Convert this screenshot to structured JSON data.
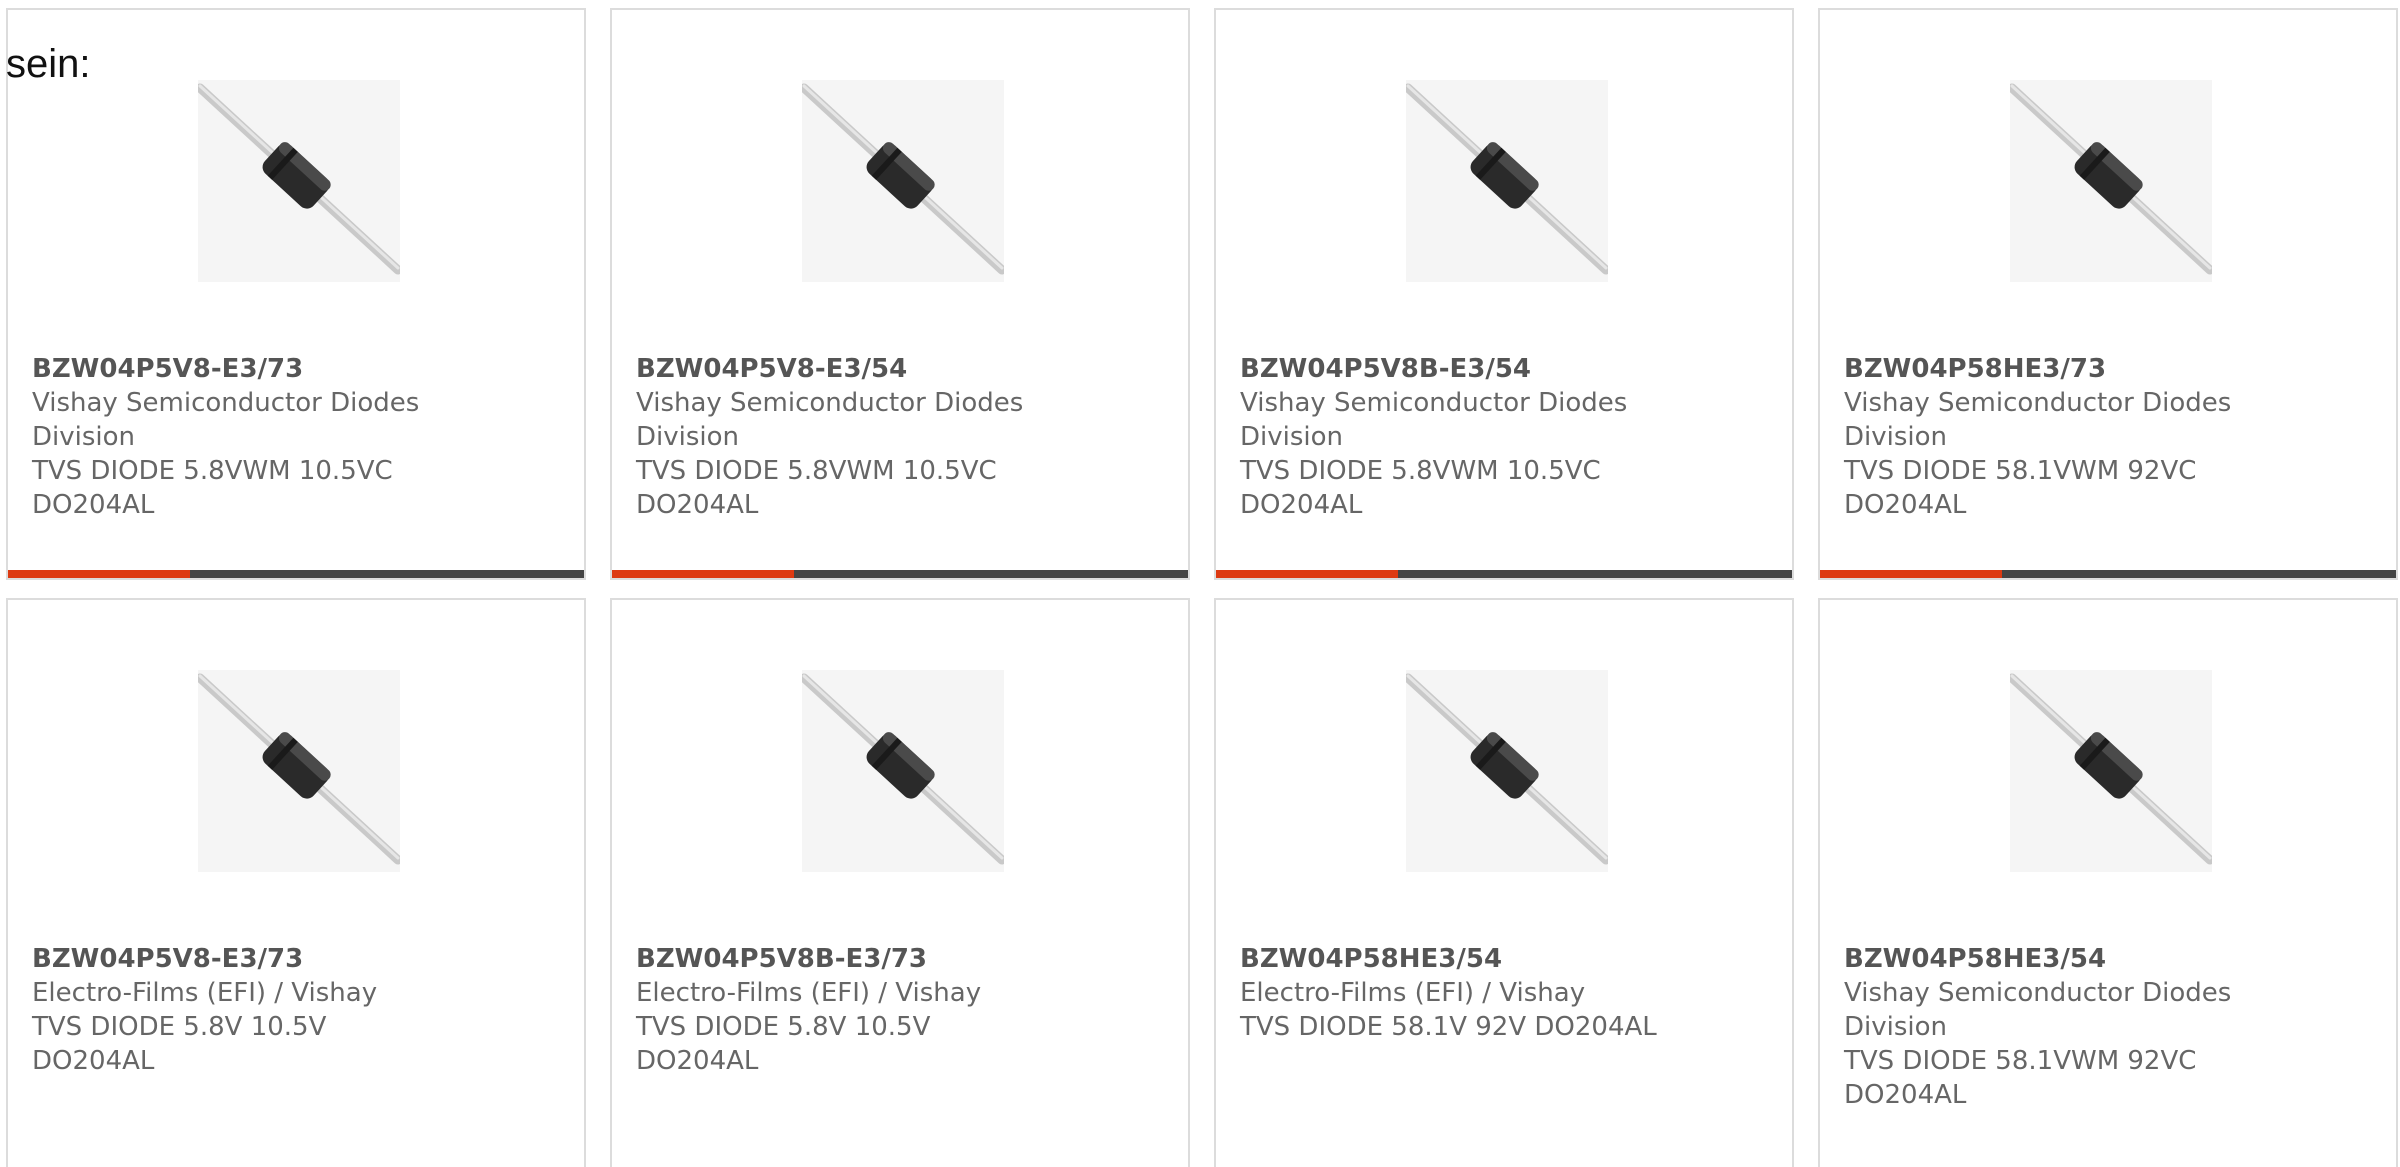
{
  "intro_text": "sein:",
  "colors": {
    "accent": "#dd3a12",
    "bar": "#444444",
    "border": "#dcdcdc",
    "text": "#666666"
  },
  "products": [
    {
      "part_number": "BZW04P5V8-E3/73",
      "manufacturer": "Vishay Semiconductor Diodes Division",
      "description": "TVS DIODE 5.8VWM 10.5VC DO204AL",
      "image": "axial-diode-icon"
    },
    {
      "part_number": "BZW04P5V8-E3/54",
      "manufacturer": "Vishay Semiconductor Diodes Division",
      "description": "TVS DIODE 5.8VWM 10.5VC DO204AL",
      "image": "axial-diode-icon"
    },
    {
      "part_number": "BZW04P5V8B-E3/54",
      "manufacturer": "Vishay Semiconductor Diodes Division",
      "description": "TVS DIODE 5.8VWM 10.5VC DO204AL",
      "image": "axial-diode-icon"
    },
    {
      "part_number": "BZW04P58HE3/73",
      "manufacturer": "Vishay Semiconductor Diodes Division",
      "description": "TVS DIODE 58.1VWM 92VC DO204AL",
      "image": "axial-diode-icon"
    },
    {
      "part_number": "BZW04P5V8-E3/73",
      "manufacturer": "Electro-Films (EFI) / Vishay",
      "description": "TVS DIODE 5.8V 10.5V DO204AL",
      "image": "axial-diode-icon"
    },
    {
      "part_number": "BZW04P5V8B-E3/73",
      "manufacturer": "Electro-Films (EFI) / Vishay",
      "description": "TVS DIODE 5.8V 10.5V DO204AL",
      "image": "axial-diode-icon"
    },
    {
      "part_number": "BZW04P58HE3/54",
      "manufacturer": "Electro-Films (EFI) / Vishay",
      "description": "TVS DIODE 58.1V 92V DO204AL",
      "image": "axial-diode-icon"
    },
    {
      "part_number": "BZW04P58HE3/54",
      "manufacturer": "Vishay Semiconductor Diodes Division",
      "description": "TVS DIODE 58.1VWM 92VC DO204AL",
      "image": "axial-diode-icon"
    }
  ]
}
